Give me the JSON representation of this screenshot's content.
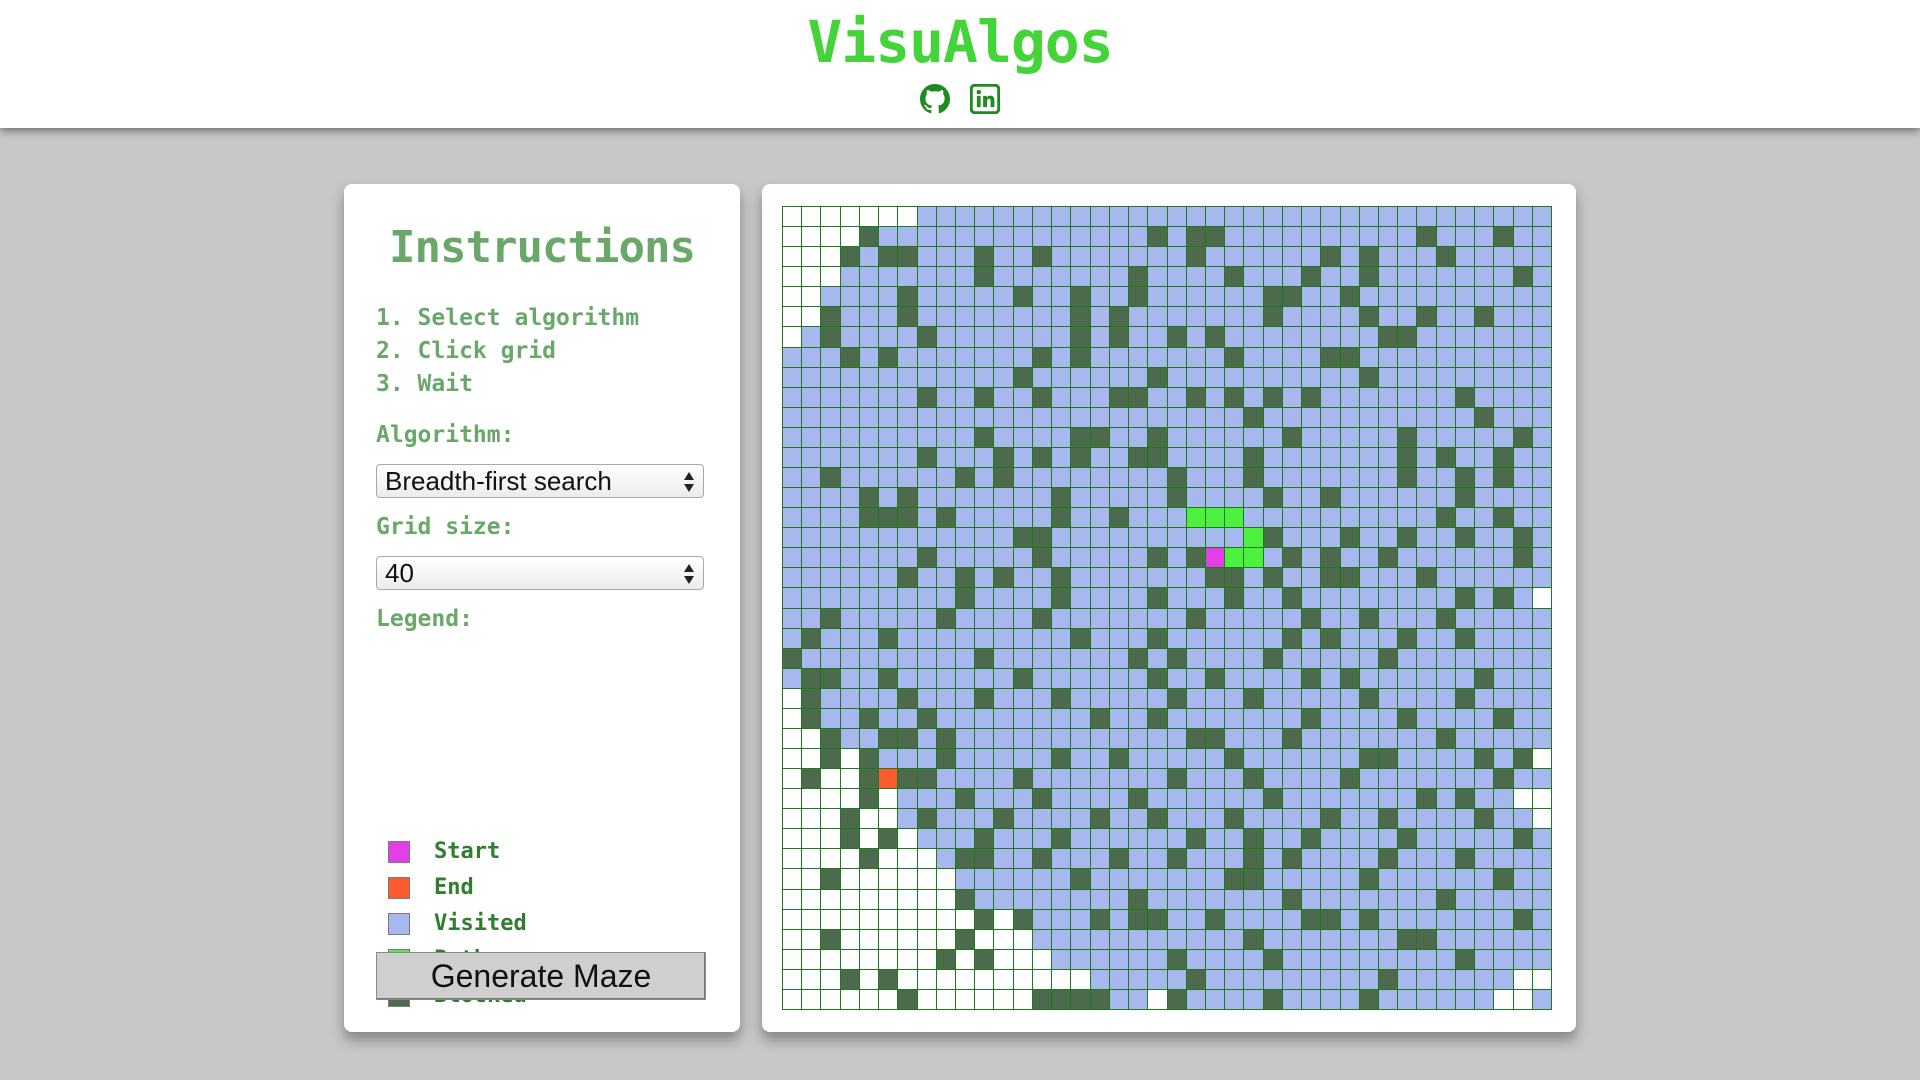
{
  "app": {
    "title": "VisuAlgos",
    "links": [
      {
        "name": "github-icon"
      },
      {
        "name": "linkedin-icon"
      }
    ]
  },
  "sidebar": {
    "title": "Instructions",
    "steps": [
      "1. Select algorithm",
      "2. Click grid",
      "3. Wait"
    ],
    "algorithm_label": "Algorithm:",
    "algorithm_value": "Breadth-first search",
    "grid_size_label": "Grid size:",
    "grid_size_value": "40",
    "legend_label": "Legend:",
    "legend": [
      {
        "label": "Start",
        "color": "#e43ee6"
      },
      {
        "label": "End",
        "color": "#ff5a2e"
      },
      {
        "label": "Visited",
        "color": "#a6b8ee"
      },
      {
        "label": "Path",
        "color": "#4df03f"
      },
      {
        "label": "Blocked",
        "color": "#4c6b4c"
      }
    ],
    "generate_label": "Generate Maze"
  },
  "colors": {
    "accent": "#45d33a",
    "grid_line": "#1d7a1d",
    "empty": "#ffffff"
  },
  "grid": {
    "rows": 40,
    "cols": 40,
    "start": [
      17,
      22
    ],
    "end": [
      28,
      5
    ],
    "path": [
      [
        15,
        21
      ],
      [
        15,
        22
      ],
      [
        15,
        23
      ],
      [
        16,
        24
      ],
      [
        17,
        23
      ],
      [
        17,
        24
      ]
    ],
    "blocked": [
      [
        1,
        4
      ],
      [
        1,
        19
      ],
      [
        1,
        21
      ],
      [
        1,
        22
      ],
      [
        1,
        33
      ],
      [
        1,
        37
      ],
      [
        2,
        3
      ],
      [
        2,
        5
      ],
      [
        2,
        6
      ],
      [
        2,
        10
      ],
      [
        2,
        13
      ],
      [
        2,
        21
      ],
      [
        2,
        28
      ],
      [
        2,
        30
      ],
      [
        2,
        34
      ],
      [
        3,
        10
      ],
      [
        3,
        18
      ],
      [
        3,
        23
      ],
      [
        3,
        27
      ],
      [
        3,
        30
      ],
      [
        3,
        38
      ],
      [
        4,
        6
      ],
      [
        4,
        12
      ],
      [
        4,
        15
      ],
      [
        4,
        18
      ],
      [
        4,
        25
      ],
      [
        4,
        26
      ],
      [
        4,
        29
      ],
      [
        5,
        2
      ],
      [
        5,
        6
      ],
      [
        5,
        15
      ],
      [
        5,
        17
      ],
      [
        5,
        25
      ],
      [
        5,
        30
      ],
      [
        5,
        33
      ],
      [
        5,
        36
      ],
      [
        6,
        2
      ],
      [
        6,
        7
      ],
      [
        6,
        15
      ],
      [
        6,
        17
      ],
      [
        6,
        20
      ],
      [
        6,
        22
      ],
      [
        6,
        31
      ],
      [
        6,
        32
      ],
      [
        7,
        3
      ],
      [
        7,
        5
      ],
      [
        7,
        13
      ],
      [
        7,
        15
      ],
      [
        7,
        23
      ],
      [
        7,
        28
      ],
      [
        7,
        29
      ],
      [
        8,
        12
      ],
      [
        8,
        19
      ],
      [
        8,
        30
      ],
      [
        9,
        7
      ],
      [
        9,
        10
      ],
      [
        9,
        13
      ],
      [
        9,
        17
      ],
      [
        9,
        18
      ],
      [
        9,
        21
      ],
      [
        9,
        23
      ],
      [
        9,
        25
      ],
      [
        9,
        27
      ],
      [
        9,
        35
      ],
      [
        10,
        24
      ],
      [
        10,
        36
      ],
      [
        11,
        10
      ],
      [
        11,
        15
      ],
      [
        11,
        16
      ],
      [
        11,
        19
      ],
      [
        11,
        26
      ],
      [
        11,
        32
      ],
      [
        11,
        38
      ],
      [
        12,
        7
      ],
      [
        12,
        11
      ],
      [
        12,
        13
      ],
      [
        12,
        15
      ],
      [
        12,
        18
      ],
      [
        12,
        19
      ],
      [
        12,
        24
      ],
      [
        12,
        32
      ],
      [
        12,
        34
      ],
      [
        12,
        37
      ],
      [
        13,
        2
      ],
      [
        13,
        9
      ],
      [
        13,
        11
      ],
      [
        13,
        20
      ],
      [
        13,
        24
      ],
      [
        13,
        32
      ],
      [
        13,
        35
      ],
      [
        13,
        37
      ],
      [
        14,
        4
      ],
      [
        14,
        6
      ],
      [
        14,
        14
      ],
      [
        14,
        20
      ],
      [
        14,
        25
      ],
      [
        14,
        28
      ],
      [
        14,
        35
      ],
      [
        15,
        4
      ],
      [
        15,
        5
      ],
      [
        15,
        6
      ],
      [
        15,
        8
      ],
      [
        15,
        14
      ],
      [
        15,
        17
      ],
      [
        15,
        34
      ],
      [
        15,
        37
      ],
      [
        16,
        12
      ],
      [
        16,
        13
      ],
      [
        16,
        25
      ],
      [
        16,
        29
      ],
      [
        16,
        32
      ],
      [
        16,
        35
      ],
      [
        16,
        38
      ],
      [
        17,
        7
      ],
      [
        17,
        13
      ],
      [
        17,
        19
      ],
      [
        17,
        21
      ],
      [
        17,
        26
      ],
      [
        17,
        28
      ],
      [
        17,
        31
      ],
      [
        17,
        38
      ],
      [
        18,
        6
      ],
      [
        18,
        9
      ],
      [
        18,
        11
      ],
      [
        18,
        14
      ],
      [
        18,
        22
      ],
      [
        18,
        23
      ],
      [
        18,
        25
      ],
      [
        18,
        28
      ],
      [
        18,
        29
      ],
      [
        18,
        33
      ],
      [
        19,
        9
      ],
      [
        19,
        14
      ],
      [
        19,
        19
      ],
      [
        19,
        23
      ],
      [
        19,
        26
      ],
      [
        19,
        35
      ],
      [
        19,
        37
      ],
      [
        20,
        2
      ],
      [
        20,
        8
      ],
      [
        20,
        13
      ],
      [
        20,
        21
      ],
      [
        20,
        27
      ],
      [
        20,
        30
      ],
      [
        20,
        34
      ],
      [
        21,
        1
      ],
      [
        21,
        5
      ],
      [
        21,
        15
      ],
      [
        21,
        19
      ],
      [
        21,
        26
      ],
      [
        21,
        28
      ],
      [
        21,
        32
      ],
      [
        21,
        35
      ],
      [
        22,
        0
      ],
      [
        22,
        10
      ],
      [
        22,
        18
      ],
      [
        22,
        20
      ],
      [
        22,
        25
      ],
      [
        22,
        31
      ],
      [
        23,
        1
      ],
      [
        23,
        2
      ],
      [
        23,
        5
      ],
      [
        23,
        12
      ],
      [
        23,
        19
      ],
      [
        23,
        22
      ],
      [
        23,
        27
      ],
      [
        23,
        29
      ],
      [
        23,
        36
      ],
      [
        24,
        1
      ],
      [
        24,
        6
      ],
      [
        24,
        10
      ],
      [
        24,
        14
      ],
      [
        24,
        20
      ],
      [
        24,
        24
      ],
      [
        24,
        30
      ],
      [
        24,
        35
      ],
      [
        25,
        1
      ],
      [
        25,
        4
      ],
      [
        25,
        7
      ],
      [
        25,
        16
      ],
      [
        25,
        19
      ],
      [
        25,
        27
      ],
      [
        25,
        32
      ],
      [
        25,
        37
      ],
      [
        26,
        2
      ],
      [
        26,
        5
      ],
      [
        26,
        6
      ],
      [
        26,
        8
      ],
      [
        26,
        21
      ],
      [
        26,
        22
      ],
      [
        26,
        26
      ],
      [
        26,
        34
      ],
      [
        27,
        2
      ],
      [
        27,
        4
      ],
      [
        27,
        8
      ],
      [
        27,
        14
      ],
      [
        27,
        17
      ],
      [
        27,
        23
      ],
      [
        27,
        30
      ],
      [
        27,
        31
      ],
      [
        27,
        36
      ],
      [
        27,
        38
      ],
      [
        28,
        1
      ],
      [
        28,
        4
      ],
      [
        28,
        6
      ],
      [
        28,
        7
      ],
      [
        28,
        12
      ],
      [
        28,
        20
      ],
      [
        28,
        24
      ],
      [
        28,
        29
      ],
      [
        28,
        37
      ],
      [
        29,
        4
      ],
      [
        29,
        9
      ],
      [
        29,
        13
      ],
      [
        29,
        18
      ],
      [
        29,
        25
      ],
      [
        29,
        33
      ],
      [
        29,
        35
      ],
      [
        30,
        3
      ],
      [
        30,
        7
      ],
      [
        30,
        11
      ],
      [
        30,
        16
      ],
      [
        30,
        19
      ],
      [
        30,
        23
      ],
      [
        30,
        28
      ],
      [
        30,
        31
      ],
      [
        30,
        36
      ],
      [
        31,
        3
      ],
      [
        31,
        5
      ],
      [
        31,
        10
      ],
      [
        31,
        14
      ],
      [
        31,
        21
      ],
      [
        31,
        24
      ],
      [
        31,
        27
      ],
      [
        31,
        32
      ],
      [
        31,
        38
      ],
      [
        32,
        4
      ],
      [
        32,
        9
      ],
      [
        32,
        10
      ],
      [
        32,
        13
      ],
      [
        32,
        17
      ],
      [
        32,
        20
      ],
      [
        32,
        24
      ],
      [
        32,
        26
      ],
      [
        32,
        31
      ],
      [
        32,
        35
      ],
      [
        33,
        2
      ],
      [
        33,
        15
      ],
      [
        33,
        23
      ],
      [
        33,
        24
      ],
      [
        33,
        30
      ],
      [
        33,
        37
      ],
      [
        34,
        9
      ],
      [
        34,
        18
      ],
      [
        34,
        26
      ],
      [
        34,
        34
      ],
      [
        35,
        10
      ],
      [
        35,
        12
      ],
      [
        35,
        16
      ],
      [
        35,
        18
      ],
      [
        35,
        19
      ],
      [
        35,
        22
      ],
      [
        35,
        27
      ],
      [
        35,
        28
      ],
      [
        35,
        30
      ],
      [
        35,
        38
      ],
      [
        36,
        2
      ],
      [
        36,
        9
      ],
      [
        36,
        24
      ],
      [
        36,
        32
      ],
      [
        36,
        33
      ],
      [
        37,
        8
      ],
      [
        37,
        10
      ],
      [
        37,
        20
      ],
      [
        37,
        25
      ],
      [
        37,
        35
      ],
      [
        38,
        3
      ],
      [
        38,
        5
      ],
      [
        38,
        21
      ],
      [
        38,
        31
      ],
      [
        39,
        6
      ],
      [
        39,
        13
      ],
      [
        39,
        14
      ],
      [
        39,
        15
      ],
      [
        39,
        16
      ],
      [
        39,
        20
      ],
      [
        39,
        25
      ],
      [
        39,
        30
      ]
    ],
    "empty_rows": [
      [
        0,
        0,
        6
      ],
      [
        1,
        0,
        4
      ],
      [
        2,
        0,
        3
      ],
      [
        3,
        0,
        2
      ],
      [
        4,
        0,
        1
      ],
      [
        5,
        0,
        1
      ],
      [
        6,
        0,
        0
      ],
      [
        19,
        39,
        39
      ],
      [
        24,
        0,
        0
      ],
      [
        25,
        0,
        0
      ],
      [
        26,
        0,
        1
      ],
      [
        27,
        0,
        4
      ],
      [
        27,
        39,
        39
      ],
      [
        28,
        0,
        4
      ],
      [
        29,
        0,
        5
      ],
      [
        29,
        38,
        39
      ],
      [
        30,
        0,
        5
      ],
      [
        30,
        39,
        39
      ],
      [
        31,
        0,
        6
      ],
      [
        32,
        0,
        7
      ],
      [
        33,
        0,
        8
      ],
      [
        34,
        0,
        9
      ],
      [
        35,
        0,
        11
      ],
      [
        36,
        0,
        12
      ],
      [
        37,
        0,
        13
      ],
      [
        38,
        0,
        15
      ],
      [
        38,
        38,
        39
      ],
      [
        39,
        0,
        12
      ],
      [
        39,
        19,
        19
      ],
      [
        39,
        37,
        38
      ]
    ]
  }
}
